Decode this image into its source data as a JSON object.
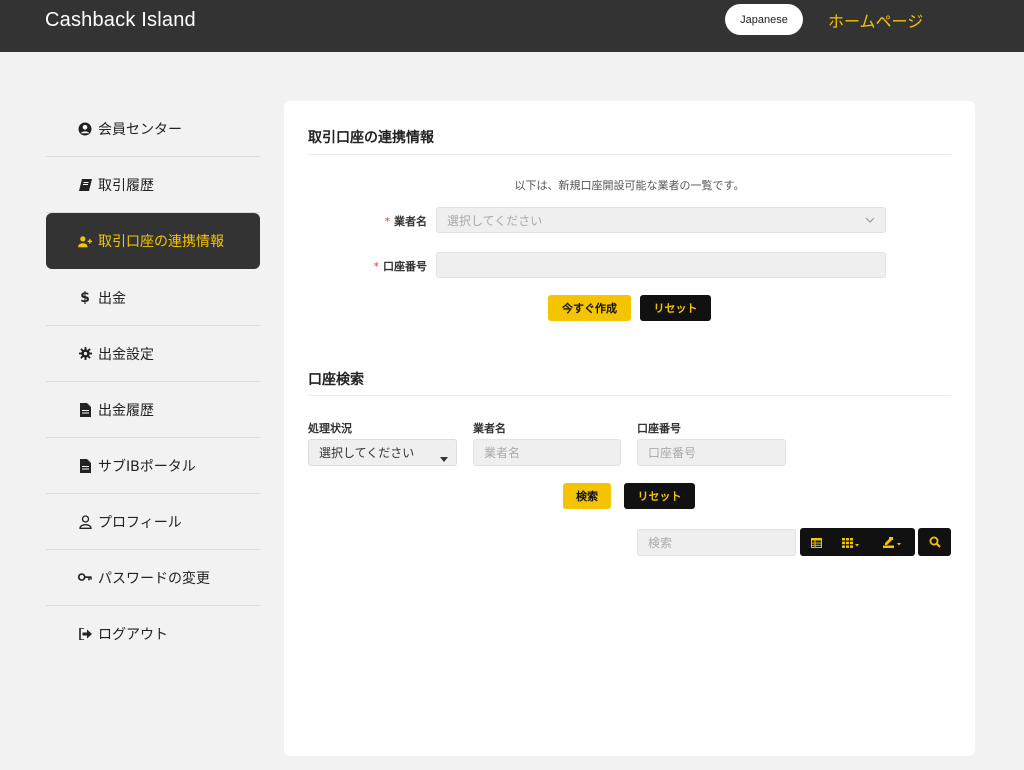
{
  "header": {
    "brand": "Cashback Island",
    "language_label": "Japanese",
    "home_link": "ホームページ"
  },
  "sidebar": {
    "items": [
      {
        "label": "会員センター",
        "icon": "user-circle-icon"
      },
      {
        "label": "取引履歴",
        "icon": "book-icon"
      },
      {
        "label": "取引口座の連携情報",
        "icon": "user-plus-icon",
        "active": true
      },
      {
        "label": "出金",
        "icon": "dollar-icon"
      },
      {
        "label": "出金設定",
        "icon": "gear-icon"
      },
      {
        "label": "出金履歴",
        "icon": "document-icon"
      },
      {
        "label": "サブIBポータル",
        "icon": "document-icon"
      },
      {
        "label": "プロフィール",
        "icon": "user-outline-icon"
      },
      {
        "label": "パスワードの変更",
        "icon": "key-icon"
      },
      {
        "label": "ログアウト",
        "icon": "sign-out-icon"
      }
    ]
  },
  "link_form": {
    "title": "取引口座の連携情報",
    "note": "以下は、新規口座開設可能な業者の一覧です。",
    "broker_label": "業者名",
    "broker_placeholder": "選択してください",
    "account_label": "口座番号",
    "account_value": "",
    "create_button": "今すぐ作成",
    "reset_button": "リセット"
  },
  "search_form": {
    "title": "口座検索",
    "status_label": "処理状況",
    "status_value": "選択してください",
    "broker_label": "業者名",
    "broker_placeholder": "業者名",
    "account_label": "口座番号",
    "account_placeholder": "口座番号",
    "search_button": "検索",
    "reset_button": "リセット"
  },
  "table_toolbar": {
    "search_placeholder": "検索",
    "icons": [
      "table-icon",
      "columns-grid-icon",
      "export-icon",
      "search-icon"
    ]
  },
  "colors": {
    "header_bg": "#333333",
    "accent": "#f5c400",
    "dark_button": "#111111"
  }
}
